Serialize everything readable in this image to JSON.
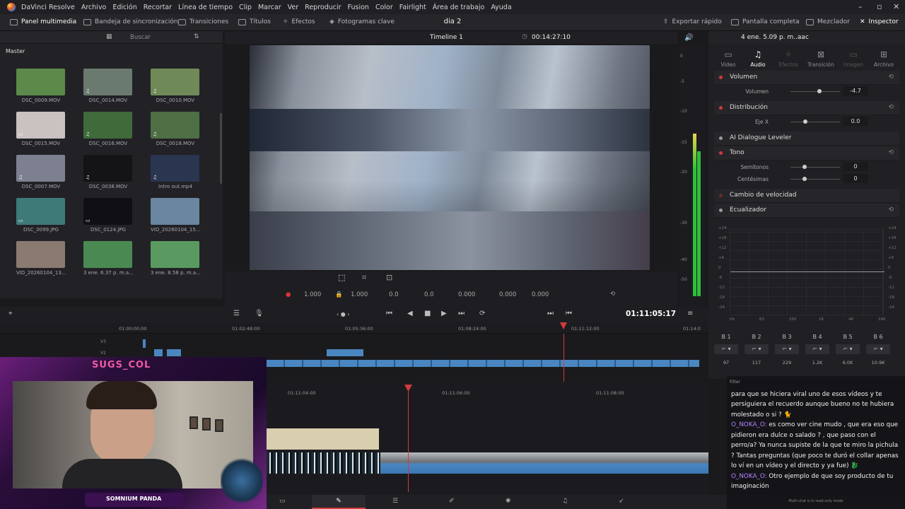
{
  "menu": {
    "app": "DaVinci Resolve",
    "items": [
      "Archivo",
      "Edición",
      "Recortar",
      "Línea de tiempo",
      "Clip",
      "Marcar",
      "Ver",
      "Reproducir",
      "Fusion",
      "Color",
      "Fairlight",
      "Área de trabajo",
      "Ayuda"
    ]
  },
  "toolbar": {
    "media_pool": "Panel multimedia",
    "sync_bin": "Bandeja de sincronización",
    "transitions": "Transiciones",
    "titles": "Títulos",
    "effects": "Efectos",
    "keyframes": "Fotogramas clave",
    "project": "dia 2",
    "quick_export": "Exportar rápido",
    "fullscreen": "Pantalla completa",
    "mixer": "Mezclador",
    "inspector": "Inspector"
  },
  "media": {
    "search_placeholder": "Buscar",
    "bin": "Master",
    "clips": [
      {
        "name": "DSC_0009.MOV",
        "color": "#5b8a4a",
        "badge": ""
      },
      {
        "name": "DSC_0014.MOV",
        "color": "#6a7a6e",
        "badge": "♫"
      },
      {
        "name": "DSC_0010.MOV",
        "color": "#6f8a58",
        "badge": "♫"
      },
      {
        "name": "DSC_0015.MOV",
        "color": "#c9c2c0",
        "badge": "▭"
      },
      {
        "name": "DSC_0016.MOV",
        "color": "#3f6a3a",
        "badge": "♫"
      },
      {
        "name": "DSC_0018.MOV",
        "color": "#4e6e44",
        "badge": "♫"
      },
      {
        "name": "DSC_0007.MOV",
        "color": "#7d8090",
        "badge": "♫"
      },
      {
        "name": "DSC_0038.MOV",
        "color": "#141416",
        "badge": "♫"
      },
      {
        "name": "Intro out.mp4",
        "color": "#2a3550",
        "badge": "♫"
      },
      {
        "name": "DSC_0099.JPG",
        "color": "#3e7a78",
        "badge": "▭"
      },
      {
        "name": "DSC_0124.JPG",
        "color": "#101014",
        "badge": "▭"
      },
      {
        "name": "VID_20260104_15...",
        "color": "#6a86a0",
        "badge": ""
      },
      {
        "name": "VID_20260104_13...",
        "color": "#8a7a70",
        "badge": ""
      },
      {
        "name": "3 ene. 6.37 p. m.a...",
        "color": "#4a8a52",
        "badge": ""
      },
      {
        "name": "3 ene. 8.58 p. m.a...",
        "color": "#5a9a60",
        "badge": ""
      }
    ]
  },
  "viewer": {
    "timeline": "Timeline 1",
    "duration": "00:14:27:10",
    "zoom_x": "1.000",
    "zoom_y": "1.000",
    "pos_x": "0.0",
    "pos_y": "0.0",
    "rotation": "0.000",
    "pitch": "0.000",
    "yaw": "0.000"
  },
  "transport": {
    "timecode": "01:11:05:17"
  },
  "ruler": [
    "01:00:00:00",
    "01:02:48:00",
    "01:05:36:00",
    "01:08:24:00",
    "01:11:12:00",
    "01:14:0"
  ],
  "ruler2": [
    "01:11:04:00",
    "01:11:06:00",
    "01:11:08:00"
  ],
  "tracks": {
    "v3": "V3",
    "v2": "V2"
  },
  "meter": [
    "0",
    "-5",
    "-10",
    "-15",
    "-20",
    "-30",
    "-40",
    "-50"
  ],
  "inspector": {
    "clip": "4 ene. 5.09 p. m..aac",
    "tabs": [
      "Video",
      "Audio",
      "Efectos",
      "Transición",
      "Imagen",
      "Archivo"
    ],
    "volume": {
      "title": "Volumen",
      "label": "Volumen",
      "value": "-4.7"
    },
    "pan": {
      "title": "Distribución",
      "label": "Eje X",
      "value": "0.0"
    },
    "leveler": "AI Dialogue Leveler",
    "pitch": {
      "title": "Tono",
      "semitones": "Semitonos",
      "semitones_val": "0",
      "cents": "Centésimas",
      "cents_val": "0"
    },
    "speed": "Cambio de velocidad",
    "eq": {
      "title": "Ecualizador",
      "y": [
        "+24",
        "+18",
        "+12",
        "+6",
        "0",
        "-6",
        "-12",
        "-18",
        "-24"
      ],
      "x": [
        "Hz",
        "62",
        "250",
        "1K",
        "4K",
        "16K"
      ]
    },
    "bands": [
      {
        "name": "B 1",
        "val": "97"
      },
      {
        "name": "B 2",
        "val": "117"
      },
      {
        "name": "B 3",
        "val": "229"
      },
      {
        "name": "B 4",
        "val": "1.2K"
      },
      {
        "name": "B 5",
        "val": "6.0K"
      },
      {
        "name": "B 6",
        "val": "10.9K"
      }
    ]
  },
  "chat": {
    "filter": "Filter",
    "messages": [
      {
        "nick": "",
        "text": "para que se hiciera viral uno de esos vídeos y te persiguiera el recuerdo aunque bueno no te hubiera molestado o si ? 🐈"
      },
      {
        "nick": "O_NOKA_O:",
        "text": "es como ver cine mudo , que era eso que pidieron era dulce o salado ? , que paso con el perro/a? Ya nunca supiste de la que te miro la pichula ? Tantas preguntas (que poco te duró el collar apenas lo ví en un vídeo y el directo y ya fue) 🐉"
      },
      {
        "nick": "O_NOKA_O:",
        "text": "Otro ejemplo de que soy producto de tu imaginación"
      }
    ],
    "footer": "Multi chat is in read only mode"
  },
  "stream": {
    "title": "SUGS_COL",
    "name": "SOMNIUM PANDA"
  }
}
